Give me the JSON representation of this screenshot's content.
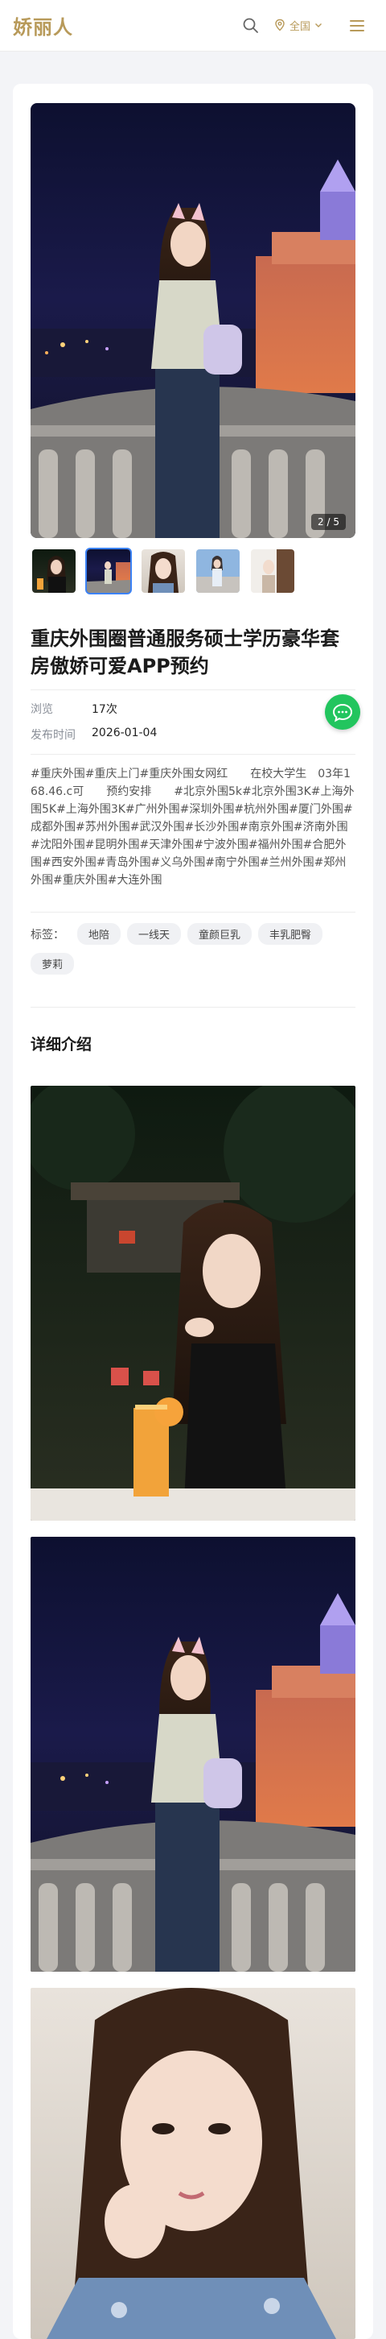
{
  "header": {
    "logo": "娇丽人",
    "location": "全国",
    "icons": [
      "search-icon",
      "location-pin-icon",
      "chevron-down-icon",
      "menu-icon"
    ],
    "accent": "#b89a5a"
  },
  "gallery": {
    "counter": "2 / 5",
    "active_index": 1,
    "thumb_count": 5,
    "active_border": "#3b82f6"
  },
  "post": {
    "title": "重庆外围圈普通服务硕士学历豪华套房傲娇可爱APP预约",
    "views_label": "浏览",
    "views_value": "17次",
    "date_label": "发布时间",
    "date_value": "2026-01-04",
    "description": "#重庆外围#重庆上门#重庆外围女网红　　在校大学生　03年168.46.c可　　预约安排　　#北京外围5k#北京外围3K#上海外围5K#上海外围3K#广州外围#深圳外围#杭州外围#厦门外围#成都外围#苏州外围#武汉外围#长沙外围#南京外围#济南外围#沈阳外围#昆明外围#天津外围#宁波外围#福州外围#合肥外围#西安外围#青岛外围#义乌外围#南宁外围#兰州外围#郑州外围#重庆外围#大连外围",
    "tags_label": "标签：",
    "tags": [
      "地陪",
      "一线天",
      "童颜巨乳",
      "丰乳肥臀",
      "萝莉"
    ]
  },
  "detail": {
    "title": "详细介绍"
  },
  "chat": {
    "icon": "chat-bubble-icon",
    "color": "#22c55e"
  }
}
